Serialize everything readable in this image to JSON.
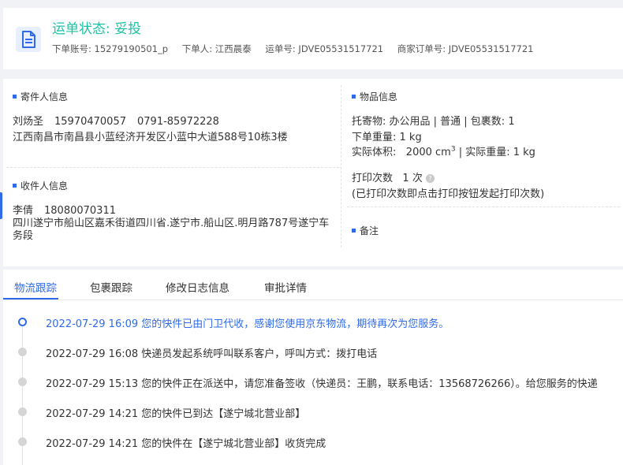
{
  "header": {
    "status_title": "运单状态: 妥投",
    "meta": [
      "下单账号: 15279190501_p",
      "下单人: 江西晨泰",
      "运单号: JDVE05531517721",
      "商家订单号: JDVE05531517721"
    ]
  },
  "sender": {
    "section_title": "寄件人信息",
    "name": "刘炀圣",
    "mobile": "15970470057",
    "phone": "0791-85972228",
    "address": "江西南昌市南昌县小蓝经济开发区小蓝中大道588号10栋3楼"
  },
  "receiver": {
    "section_title": "收件人信息",
    "name": "李倩",
    "mobile": "18080070311",
    "address": "四川遂宁市船山区嘉禾街道四川省.遂宁市.船山区.明月路787号遂宁车务段"
  },
  "goods": {
    "section_title": "物品信息",
    "line1": "托寄物: 办公用品 | 普通 | 包裹数: 1",
    "line2": "下单重量: 1 kg",
    "volume_label": "实际体积:",
    "volume_value": "2000 cm",
    "volume_sup": "3",
    "actual_weight": "| 实际重量: 1 kg",
    "print_label": "打印次数",
    "print_value": "1 次",
    "print_note": "(已打印次数即点击打印按钮发起打印次数)",
    "help_icon": "question-circle-icon"
  },
  "remark": {
    "section_title": "备注"
  },
  "tabs": [
    "物流跟踪",
    "包裹跟踪",
    "修改日志信息",
    "审批详情"
  ],
  "timeline": [
    "2022-07-29 16:09 您的快件已由门卫代收，感谢您使用京东物流，期待再次为您服务。",
    "2022-07-29 16:08 快递员发起系统呼叫联系客户，呼叫方式：拨打电话",
    "2022-07-29 15:13 您的快件正在派送中，请您准备签收（快递员：王鹏，联系电话：13568726266）。给您服务的快递",
    "2022-07-29 14:21 您的快件已到达【遂宁城北营业部】",
    "2022-07-29 14:21 您的快件在【遂宁城北营业部】收货完成"
  ],
  "colors": {
    "accent": "#2f6ae8",
    "status": "#1fc1a5",
    "icon_bg": "#e8efff"
  }
}
